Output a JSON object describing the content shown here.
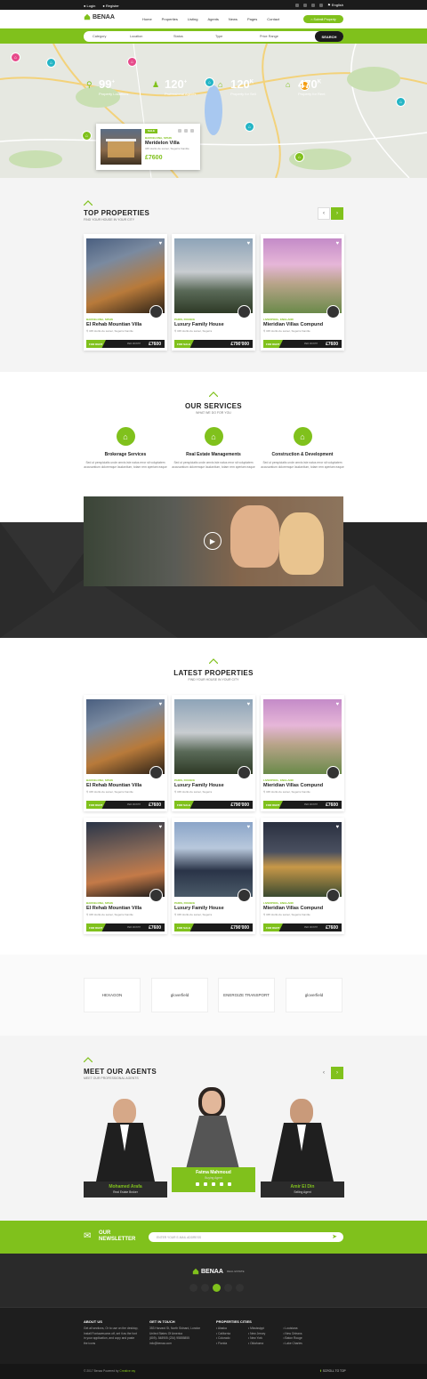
{
  "colors": {
    "accent": "#80c11c",
    "dark": "#1b1b1b"
  },
  "topbar": {
    "login": "Login",
    "register": "Register",
    "language": "English"
  },
  "header": {
    "logo": "BENAA",
    "nav": [
      "Home",
      "Properties",
      "Listing",
      "Agents",
      "News",
      "Pages",
      "Contact"
    ],
    "submit": "Submit Property"
  },
  "search": {
    "fields": [
      "Category",
      "Location",
      "Status",
      "Type",
      "Price Range"
    ],
    "button": "SEARCH"
  },
  "map_popup": {
    "badge": "SALE",
    "location": "BARCELONA, SPAIN",
    "title": "Meridelon Villa",
    "address": "345 Hortis de samer, Sugerra Familie",
    "price": "£7600"
  },
  "top": {
    "title": "TOP PROPERTIES",
    "subtitle": "FIND YOUR HOUSE IN YOUR CITY"
  },
  "cards": [
    {
      "loc": "BARCELONA, SPAIN",
      "title": "El Rehab Mountian Villa",
      "addr": "345 Hortis de samer, Sugerra Familie",
      "tag": "FOR RENT",
      "per": "PER MONTH",
      "price": "£7600"
    },
    {
      "loc": "PARIS, FRANCE",
      "title": "Luxury Family House",
      "addr": "345 Hortis de samer, Sugerra",
      "tag": "FOR SALE",
      "per": "",
      "price": "£790'000"
    },
    {
      "loc": "LIVERPOOL, ENGLAND",
      "title": "Mieridian Villas Compund",
      "addr": "345 Hortis de samer, Sugerra Familie",
      "tag": "FOR RENT",
      "per": "PER MONTH",
      "price": "£7600"
    }
  ],
  "services": {
    "title": "OUR SERVICES",
    "subtitle": "WHAT WE DO FOR YOU",
    "items": [
      {
        "t": "Brokerage Services",
        "d": "Sed ut perspiciatis unde omnis iste natus error sit voluptatem accusantium doloremque laudantium, totam rem aperiam eaque"
      },
      {
        "t": "Real Estate Managements",
        "d": "Sed ut perspiciatis unde omnis iste natus error sit voluptatem accusantium doloremque laudantium, totam rem aperiam eaque"
      },
      {
        "t": "Construction & Development",
        "d": "Sed ut perspiciatis unde omnis iste natus error sit voluptatem accusantium doloremque laudantium, totam rem aperiam eaque"
      }
    ]
  },
  "stats": [
    {
      "n": "99",
      "sup": "+",
      "lb": "Property Locations"
    },
    {
      "n": "120",
      "sup": "+",
      "lb": "Professional Agents"
    },
    {
      "n": "120",
      "sup": "K",
      "lb": "Property for Sell"
    },
    {
      "n": "470",
      "sup": "K",
      "lb": "Property for Rent"
    }
  ],
  "latest": {
    "title": "LATEST PROPERTIES",
    "subtitle": "FIND YOUR HOUSE IN YOUR CITY"
  },
  "partners": [
    "HEXAGON",
    "gloverfield",
    "ENERGIZE TRANSPORT",
    "gloverfield"
  ],
  "agents": {
    "title": "MEET OUR AGENTS",
    "subtitle": "MEET OUR PROFESSIONAL AGENTS",
    "items": [
      {
        "name": "Mohamed Arafa",
        "role": "Real Estate Broker"
      },
      {
        "name": "Fatma Mahmoud",
        "role": "Buying Agent"
      },
      {
        "name": "Amir El Din",
        "role": "Selling Agent"
      }
    ]
  },
  "newsletter": {
    "title": "OUR",
    "title2": "NEWSLETTER",
    "placeholder": "ENTER YOUR E-MAIL ADDRESS"
  },
  "footer": {
    "logo": "BENAA",
    "logo_sub": "REAL ESTATE",
    "about_h": "ABOUT US",
    "about": "Get all sections, Or to use on the desktop, Install Fontawesome.otf, set it as the font in your application, and copy and paste the icons",
    "touch_h": "GET IN TOUCH",
    "touch": [
      "353 Harvard St, North Sidnard, London",
      "United States Of America",
      "(809)- 548905 (234) 95855855",
      "info@benaa.com"
    ],
    "cities_h": "PROPERTIES CITIES",
    "cities": [
      [
        "Alaska",
        "California",
        "Colorado",
        "Florida"
      ],
      [
        "Mississippi",
        "New Jersey",
        "New York",
        "Oklahoma"
      ],
      [
        "Louisiana",
        "New Orleans",
        "Baton Rouge",
        "Lake Charles"
      ]
    ],
    "copy": "© 2017 Benaa Powered by",
    "copy_by": "Creative ray",
    "scroll": "SCROLL TO TOP"
  }
}
